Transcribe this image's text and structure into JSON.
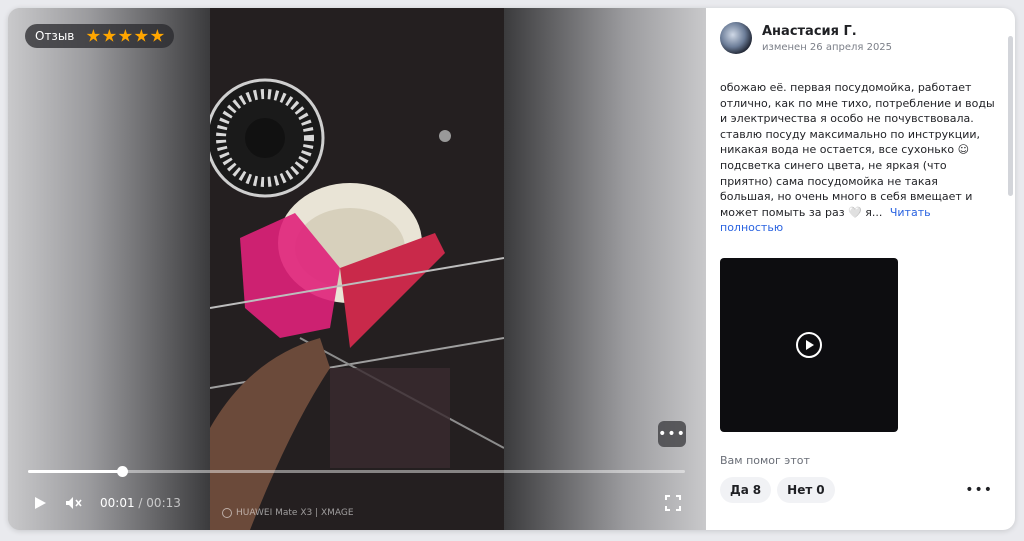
{
  "player": {
    "badge_label": "Отзыв",
    "rating": 5,
    "current_time": "00:01",
    "separator": "/",
    "duration": "00:13",
    "progress_fraction": 0.143,
    "watermark": "HUAWEI Mate X3 | XMAGE",
    "more_label": "•••",
    "icons": {
      "play": "play-icon",
      "mute": "muted-speaker-icon",
      "fullscreen": "fullscreen-icon",
      "more": "more-dots-icon",
      "star": "star-icon"
    }
  },
  "review": {
    "author_name": "Анастасия Г.",
    "date": "изменен 26 апреля 2025",
    "text": "обожаю её. первая посудомойка, работает отлично, как по мне тихо, потребление и воды и электричества я особо не почувствовала. ставлю посуду максимально по инструкции, никакая вода не остается, все сухонько ☺ подсветка синего цвета, не яркая (что приятно) сама посудомойка не такая большая, но очень много в себя вмещает и может помыть за раз 🤍 я...",
    "read_more": "Читать полностью",
    "helpful_question": "Вам помог этот",
    "yes_label": "Да",
    "yes_count": "8",
    "no_label": "Нет",
    "no_count": "0",
    "more_label": "•••"
  },
  "colors": {
    "accent_link": "#2a63e0",
    "star": "#ffa600"
  }
}
